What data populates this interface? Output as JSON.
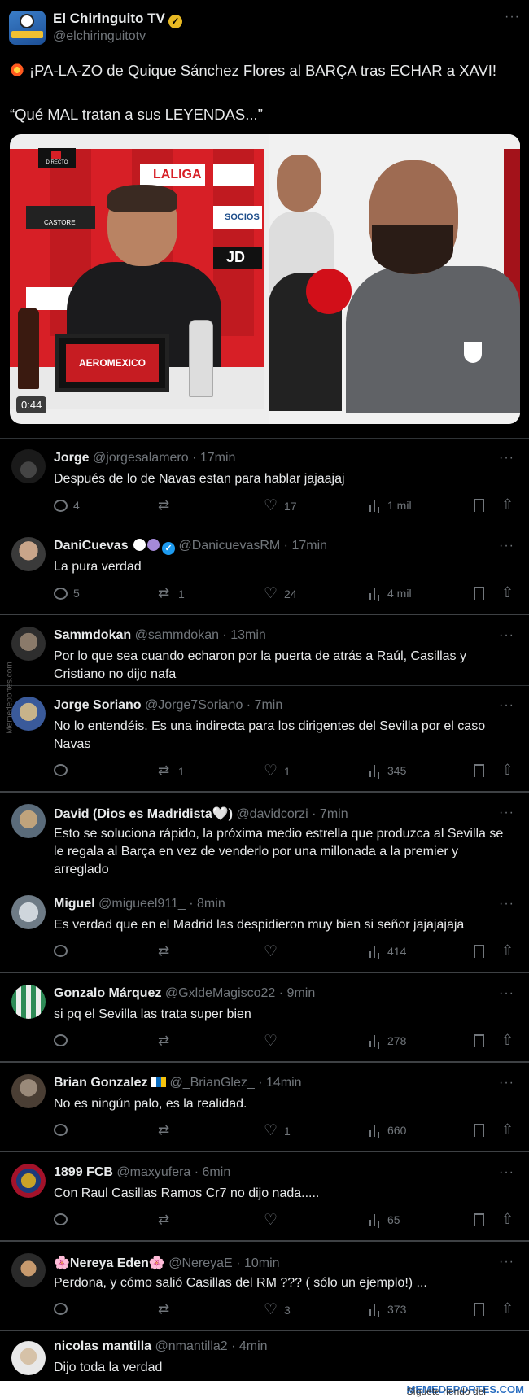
{
  "post": {
    "author_name": "El Chiringuito TV",
    "author_handle": "@elchiringuitotv",
    "text_line1": "¡PA-LA-ZO de Quique Sánchez Flores al BARÇA tras ECHAR a XAVI!",
    "text_line2": "“Qué MAL tratan a sus LEYENDAS...”",
    "video": {
      "duration": "0:44",
      "live_badge": "DIRECTO",
      "sponsor": "AEROMEXICO",
      "board_laliga": "LALIGA",
      "board_castore": "CASTORE",
      "board_socios": "SOCIOS",
      "board_jd": "JD"
    }
  },
  "replies": [
    {
      "name": "Jorge",
      "handle": "@jorgesalamero",
      "time": "17min",
      "text": "Después de lo de Navas estan para hablar jajaajaj",
      "replies": "4",
      "retweets": "",
      "likes": "17",
      "views": "1 mil"
    },
    {
      "name": "DaniCuevas",
      "handle": "@DanicuevasRM",
      "time": "17min",
      "text": "La pura verdad",
      "replies": "5",
      "retweets": "1",
      "likes": "24",
      "views": "4 mil"
    },
    {
      "name": "Sammdokan",
      "handle": "@sammdokan",
      "time": "13min",
      "text": "Por lo que sea cuando echaron por la puerta de atrás a Raúl, Casillas y Cristiano no dijo nafa"
    },
    {
      "name": "Jorge Soriano",
      "handle": "@Jorge7Soriano",
      "time": "7min",
      "text": "No lo entendéis. Es una indirecta para los dirigentes del Sevilla por el caso Navas",
      "replies": "",
      "retweets": "1",
      "likes": "1",
      "views": "345"
    },
    {
      "name": "David (Dios es Madridista🤍)",
      "handle": "@davidcorzi",
      "time": "7min",
      "text": "Esto se soluciona rápido, la próxima medio estrella que produzca al Sevilla se le regala al Barça en vez de venderlo por una millonada a la premier y arreglado"
    },
    {
      "name": "Miguel",
      "handle": "@migueel911_",
      "time": "8min",
      "text": "Es verdad que en el Madrid las despidieron muy bien si señor jajajajaja",
      "replies": "",
      "retweets": "",
      "likes": "",
      "views": "414"
    },
    {
      "name": "Gonzalo Márquez",
      "handle": "@GxldeMagisco22",
      "time": "9min",
      "text": "si pq el Sevilla las trata super bien",
      "replies": "",
      "retweets": "",
      "likes": "",
      "views": "278"
    },
    {
      "name": "Brian Gonzalez",
      "handle": "@_BrianGlez_",
      "time": "14min",
      "text": "No es ningún palo, es la realidad.",
      "replies": "",
      "retweets": "",
      "likes": "1",
      "views": "660"
    },
    {
      "name": "1899 FCB",
      "handle": "@maxyufera",
      "time": "6min",
      "text": "Con Raul Casillas Ramos Cr7 no dijo nada.....",
      "replies": "",
      "retweets": "",
      "likes": "",
      "views": "65"
    },
    {
      "name": "🌸Nereya Eden🌸",
      "handle": "@NereyaE",
      "time": "10min",
      "text": "Perdona, y cómo salió Casillas del RM ??? ( sólo un ejemplo!) ...",
      "replies": "",
      "retweets": "",
      "likes": "3",
      "views": "373"
    },
    {
      "name": "nicolas mantilla",
      "handle": "@nmantilla2",
      "time": "4min",
      "text": "Dijo toda la verdad"
    }
  ],
  "watermark": {
    "prefix": "Síguete riendo del deporte en",
    "brand": "MEMEDEPORTES.COM"
  },
  "side_tag": "Memedeportes.com",
  "colors": {
    "background": "#000000",
    "text": "#e7e9ea",
    "muted": "#71767b",
    "verified_blue": "#1d9bf0",
    "verified_gold": "#e8b923"
  }
}
